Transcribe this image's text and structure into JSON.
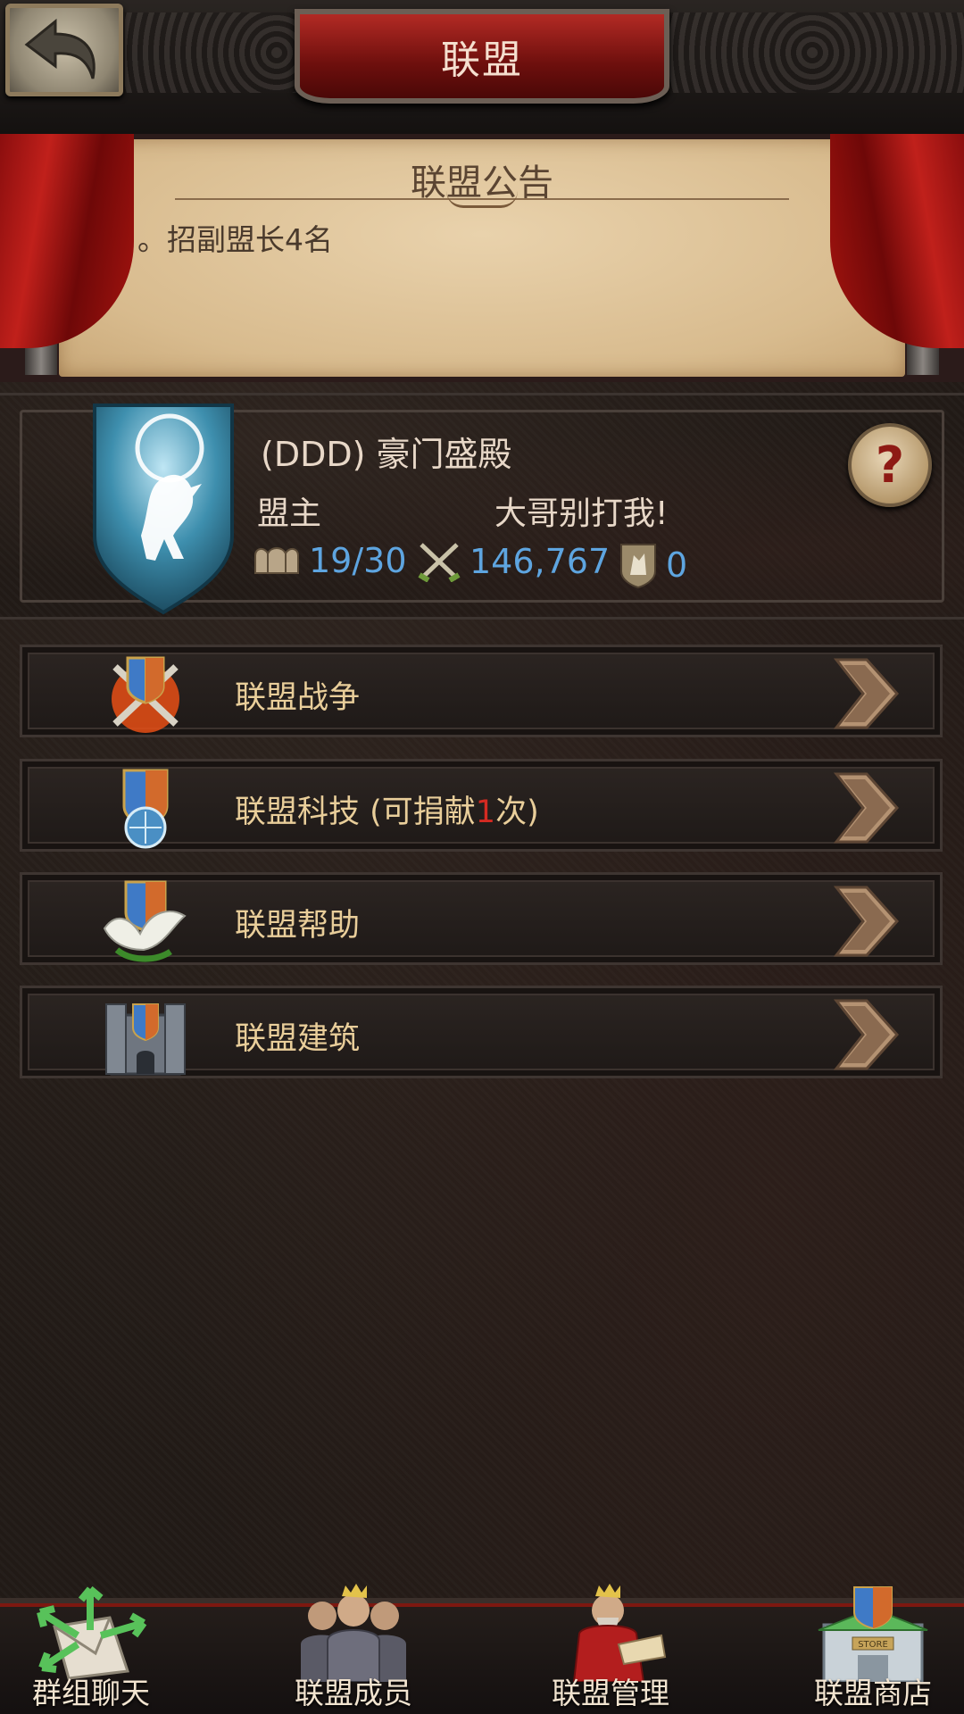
{
  "header": {
    "title": "联盟"
  },
  "announcement": {
    "title": "联盟公告",
    "text": "。。。招副盟长4名"
  },
  "alliance": {
    "name": "(DDD) 豪门盛殿",
    "leader_label": "盟主",
    "leader_name": "大哥别打我!",
    "members": "19/30",
    "power": "146,767",
    "honor": "0"
  },
  "menu": [
    {
      "label": "联盟战争"
    },
    {
      "label_prefix": "联盟科技 (可捐献",
      "label_count": "1",
      "label_suffix": "次)"
    },
    {
      "label": "联盟帮助"
    },
    {
      "label": "联盟建筑"
    }
  ],
  "nav": [
    {
      "label": "群组聊天"
    },
    {
      "label": "联盟成员"
    },
    {
      "label": "联盟管理"
    },
    {
      "label": "联盟商店"
    }
  ],
  "colors": {
    "accent_red": "#b22a24",
    "stat_blue": "#5ea5e0",
    "menu_text": "#e9ce9a"
  }
}
